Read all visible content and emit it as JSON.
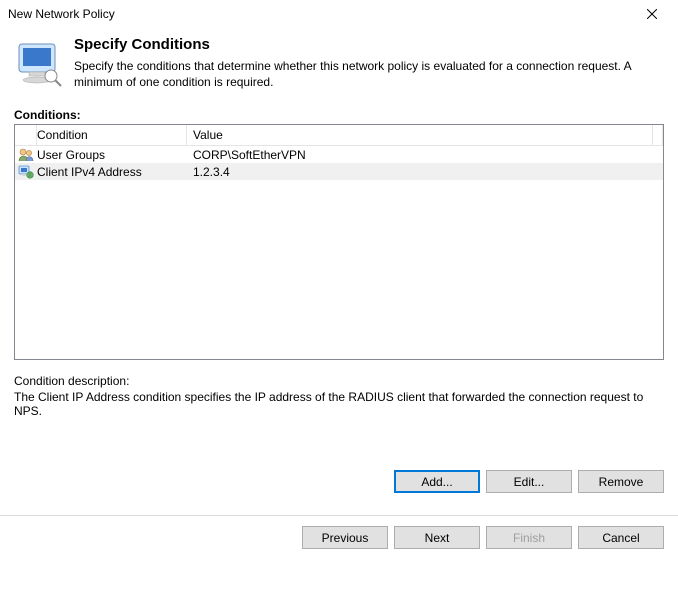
{
  "window": {
    "title": "New Network Policy"
  },
  "header": {
    "title": "Specify Conditions",
    "description": "Specify the conditions that determine whether this network policy is evaluated for a connection request. A minimum of one condition is required."
  },
  "conditions": {
    "label": "Conditions:",
    "columns": {
      "condition": "Condition",
      "value": "Value"
    },
    "rows": [
      {
        "icon": "user-groups-icon",
        "condition": "User Groups",
        "value": "CORP\\SoftEtherVPN",
        "selected": false
      },
      {
        "icon": "client-ip-icon",
        "condition": "Client IPv4 Address",
        "value": "1.2.3.4",
        "selected": true
      }
    ]
  },
  "description": {
    "label": "Condition description:",
    "text": "The Client IP Address condition specifies the IP address of the RADIUS client that forwarded the connection request to NPS."
  },
  "buttons": {
    "add": "Add...",
    "edit": "Edit...",
    "remove": "Remove",
    "previous": "Previous",
    "next": "Next",
    "finish": "Finish",
    "cancel": "Cancel"
  }
}
